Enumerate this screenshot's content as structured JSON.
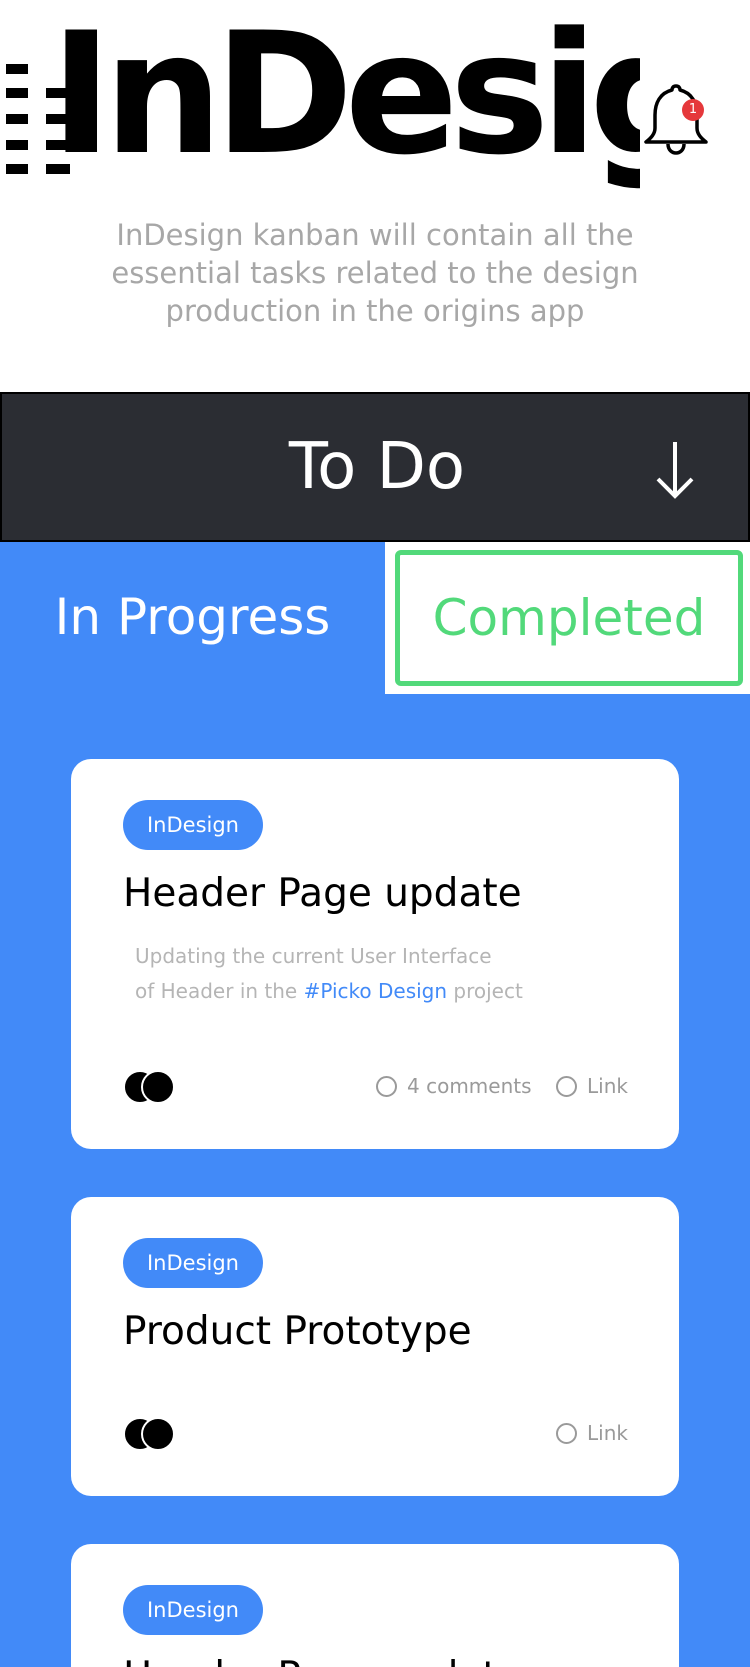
{
  "header": {
    "brand": "InDesign",
    "subtitle": "InDesign kanban will contain all the essential tasks related to the design production in the origins app",
    "notification_count": "1",
    "bell_icon": "bell-icon"
  },
  "todo": {
    "label": "To Do",
    "arrow_icon": "arrow-down-icon"
  },
  "tabs": {
    "in_progress": "In Progress",
    "completed": "Completed"
  },
  "colors": {
    "board_blue": "#428af8",
    "todo_dark": "#2b2d33",
    "completed_green": "#52d97a",
    "badge_red": "#e5383b"
  },
  "cards": [
    {
      "tag": "InDesign",
      "title": "Header Page update",
      "desc_line1": "Updating the current User Interface",
      "desc_line2_pre": "of Header in the ",
      "desc_link": "#Picko Design",
      "desc_line2_post": " project",
      "comments": "4 comments",
      "link": "Link"
    },
    {
      "tag": "InDesign",
      "title": "Product Prototype",
      "link": "Link"
    },
    {
      "tag": "InDesign",
      "title": "Header Page update"
    }
  ]
}
